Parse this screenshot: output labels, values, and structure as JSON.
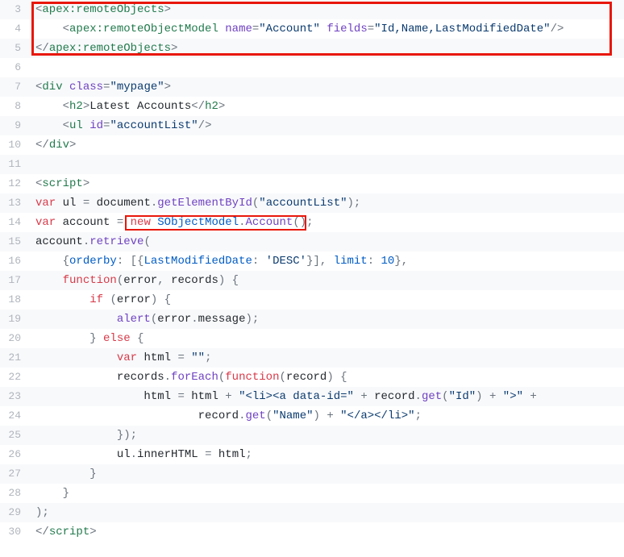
{
  "lines": [
    {
      "n": "3",
      "stripe": true,
      "tokens": [
        [
          "p",
          "<"
        ],
        [
          "tg",
          "apex:remoteObjects"
        ],
        [
          "p",
          ">"
        ]
      ]
    },
    {
      "n": "4",
      "stripe": false,
      "tokens": [
        [
          "id",
          "    "
        ],
        [
          "p",
          "<"
        ],
        [
          "tg",
          "apex:remoteObjectModel"
        ],
        [
          "id",
          " "
        ],
        [
          "at",
          "name"
        ],
        [
          "p",
          "="
        ],
        [
          "st",
          "\"Account\""
        ],
        [
          "id",
          " "
        ],
        [
          "at",
          "fields"
        ],
        [
          "p",
          "="
        ],
        [
          "st",
          "\"Id,Name,LastModifiedDate\""
        ],
        [
          "p",
          "/>"
        ]
      ]
    },
    {
      "n": "5",
      "stripe": true,
      "tokens": [
        [
          "p",
          "</"
        ],
        [
          "tg",
          "apex:remoteObjects"
        ],
        [
          "p",
          ">"
        ]
      ]
    },
    {
      "n": "6",
      "stripe": false,
      "tokens": []
    },
    {
      "n": "7",
      "stripe": true,
      "tokens": [
        [
          "p",
          "<"
        ],
        [
          "tg",
          "div"
        ],
        [
          "id",
          " "
        ],
        [
          "at",
          "class"
        ],
        [
          "p",
          "="
        ],
        [
          "st",
          "\"mypage\""
        ],
        [
          "p",
          ">"
        ]
      ]
    },
    {
      "n": "8",
      "stripe": false,
      "tokens": [
        [
          "id",
          "    "
        ],
        [
          "p",
          "<"
        ],
        [
          "tg",
          "h2"
        ],
        [
          "p",
          ">"
        ],
        [
          "id",
          "Latest Accounts"
        ],
        [
          "p",
          "</"
        ],
        [
          "tg",
          "h2"
        ],
        [
          "p",
          ">"
        ]
      ]
    },
    {
      "n": "9",
      "stripe": true,
      "tokens": [
        [
          "id",
          "    "
        ],
        [
          "p",
          "<"
        ],
        [
          "tg",
          "ul"
        ],
        [
          "id",
          " "
        ],
        [
          "at",
          "id"
        ],
        [
          "p",
          "="
        ],
        [
          "st",
          "\"accountList\""
        ],
        [
          "p",
          "/>"
        ]
      ]
    },
    {
      "n": "10",
      "stripe": false,
      "tokens": [
        [
          "p",
          "</"
        ],
        [
          "tg",
          "div"
        ],
        [
          "p",
          ">"
        ]
      ]
    },
    {
      "n": "11",
      "stripe": true,
      "tokens": []
    },
    {
      "n": "12",
      "stripe": false,
      "tokens": [
        [
          "p",
          "<"
        ],
        [
          "tg",
          "script"
        ],
        [
          "p",
          ">"
        ]
      ]
    },
    {
      "n": "13",
      "stripe": true,
      "tokens": [
        [
          "kw",
          "var"
        ],
        [
          "id",
          " ul "
        ],
        [
          "p",
          "="
        ],
        [
          "id",
          " document"
        ],
        [
          "p",
          "."
        ],
        [
          "fn",
          "getElementById"
        ],
        [
          "p",
          "("
        ],
        [
          "st",
          "\"accountList\""
        ],
        [
          "p",
          ");"
        ]
      ]
    },
    {
      "n": "14",
      "stripe": false,
      "tokens": [
        [
          "kw",
          "var"
        ],
        [
          "id",
          " account "
        ],
        [
          "p",
          "="
        ],
        [
          "id",
          " "
        ],
        [
          "kw",
          "new"
        ],
        [
          "id",
          " "
        ],
        [
          "cl",
          "SObjectModel"
        ],
        [
          "p",
          "."
        ],
        [
          "fn",
          "Account"
        ],
        [
          "p",
          "();"
        ]
      ]
    },
    {
      "n": "15",
      "stripe": true,
      "tokens": [
        [
          "id",
          "account"
        ],
        [
          "p",
          "."
        ],
        [
          "fn",
          "retrieve"
        ],
        [
          "p",
          "("
        ]
      ]
    },
    {
      "n": "16",
      "stripe": false,
      "tokens": [
        [
          "id",
          "    "
        ],
        [
          "p",
          "{"
        ],
        [
          "py",
          "orderby"
        ],
        [
          "p",
          ": [{"
        ],
        [
          "py",
          "LastModifiedDate"
        ],
        [
          "p",
          ": "
        ],
        [
          "st",
          "'DESC'"
        ],
        [
          "p",
          "}], "
        ],
        [
          "py",
          "limit"
        ],
        [
          "p",
          ": "
        ],
        [
          "nu",
          "10"
        ],
        [
          "p",
          "},"
        ]
      ]
    },
    {
      "n": "17",
      "stripe": true,
      "tokens": [
        [
          "id",
          "    "
        ],
        [
          "kw",
          "function"
        ],
        [
          "p",
          "("
        ],
        [
          "id",
          "error"
        ],
        [
          "p",
          ", "
        ],
        [
          "id",
          "records"
        ],
        [
          "p",
          ") {"
        ]
      ]
    },
    {
      "n": "18",
      "stripe": false,
      "tokens": [
        [
          "id",
          "        "
        ],
        [
          "kw",
          "if"
        ],
        [
          "id",
          " "
        ],
        [
          "p",
          "("
        ],
        [
          "id",
          "error"
        ],
        [
          "p",
          ") {"
        ]
      ]
    },
    {
      "n": "19",
      "stripe": true,
      "tokens": [
        [
          "id",
          "            "
        ],
        [
          "fn",
          "alert"
        ],
        [
          "p",
          "("
        ],
        [
          "id",
          "error"
        ],
        [
          "p",
          "."
        ],
        [
          "id",
          "message"
        ],
        [
          "p",
          ");"
        ]
      ]
    },
    {
      "n": "20",
      "stripe": false,
      "tokens": [
        [
          "id",
          "        "
        ],
        [
          "p",
          "}"
        ],
        [
          "id",
          " "
        ],
        [
          "kw",
          "else"
        ],
        [
          "id",
          " "
        ],
        [
          "p",
          "{"
        ]
      ]
    },
    {
      "n": "21",
      "stripe": true,
      "tokens": [
        [
          "id",
          "            "
        ],
        [
          "kw",
          "var"
        ],
        [
          "id",
          " html "
        ],
        [
          "p",
          "="
        ],
        [
          "id",
          " "
        ],
        [
          "st",
          "\"\""
        ],
        [
          "p",
          ";"
        ]
      ]
    },
    {
      "n": "22",
      "stripe": false,
      "tokens": [
        [
          "id",
          "            "
        ],
        [
          "id",
          "records"
        ],
        [
          "p",
          "."
        ],
        [
          "fn",
          "forEach"
        ],
        [
          "p",
          "("
        ],
        [
          "kw",
          "function"
        ],
        [
          "p",
          "("
        ],
        [
          "id",
          "record"
        ],
        [
          "p",
          ") {"
        ]
      ]
    },
    {
      "n": "23",
      "stripe": true,
      "tokens": [
        [
          "id",
          "                "
        ],
        [
          "id",
          "html "
        ],
        [
          "p",
          "="
        ],
        [
          "id",
          " html "
        ],
        [
          "p",
          "+"
        ],
        [
          "id",
          " "
        ],
        [
          "st",
          "\"<li><a data-id=\""
        ],
        [
          "id",
          " "
        ],
        [
          "p",
          "+"
        ],
        [
          "id",
          " record"
        ],
        [
          "p",
          "."
        ],
        [
          "fn",
          "get"
        ],
        [
          "p",
          "("
        ],
        [
          "st",
          "\"Id\""
        ],
        [
          "p",
          ") "
        ],
        [
          "p",
          "+"
        ],
        [
          "id",
          " "
        ],
        [
          "st",
          "\">\""
        ],
        [
          "id",
          " "
        ],
        [
          "p",
          "+"
        ]
      ]
    },
    {
      "n": "24",
      "stripe": false,
      "tokens": [
        [
          "id",
          "                        "
        ],
        [
          "id",
          "record"
        ],
        [
          "p",
          "."
        ],
        [
          "fn",
          "get"
        ],
        [
          "p",
          "("
        ],
        [
          "st",
          "\"Name\""
        ],
        [
          "p",
          ") "
        ],
        [
          "p",
          "+"
        ],
        [
          "id",
          " "
        ],
        [
          "st",
          "\"</a></li>\""
        ],
        [
          "p",
          ";"
        ]
      ]
    },
    {
      "n": "25",
      "stripe": true,
      "tokens": [
        [
          "id",
          "            "
        ],
        [
          "p",
          "});"
        ]
      ]
    },
    {
      "n": "26",
      "stripe": false,
      "tokens": [
        [
          "id",
          "            "
        ],
        [
          "id",
          "ul"
        ],
        [
          "p",
          "."
        ],
        [
          "id",
          "innerHTML"
        ],
        [
          "id",
          " "
        ],
        [
          "p",
          "="
        ],
        [
          "id",
          " html"
        ],
        [
          "p",
          ";"
        ]
      ]
    },
    {
      "n": "27",
      "stripe": true,
      "tokens": [
        [
          "id",
          "        "
        ],
        [
          "p",
          "}"
        ]
      ]
    },
    {
      "n": "28",
      "stripe": false,
      "tokens": [
        [
          "id",
          "    "
        ],
        [
          "p",
          "}"
        ]
      ]
    },
    {
      "n": "29",
      "stripe": true,
      "tokens": [
        [
          "p",
          ");"
        ]
      ]
    },
    {
      "n": "30",
      "stripe": false,
      "tokens": [
        [
          "p",
          "</"
        ],
        [
          "tg",
          "script"
        ],
        [
          "p",
          ">"
        ]
      ]
    }
  ]
}
